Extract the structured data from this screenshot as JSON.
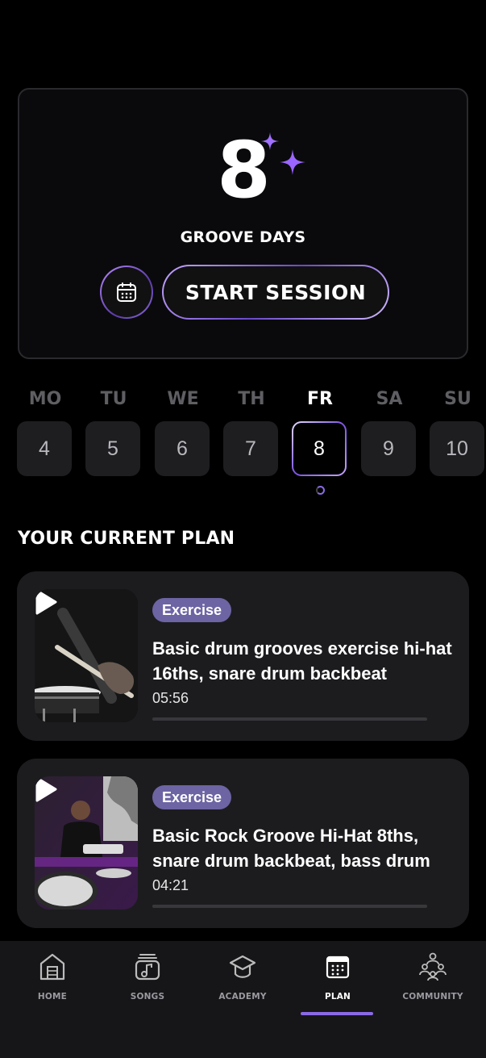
{
  "streak": {
    "count": "8",
    "label": "GROOVE DAYS"
  },
  "actions": {
    "start_label": "START SESSION"
  },
  "week": [
    {
      "name": "MO",
      "num": "4"
    },
    {
      "name": "TU",
      "num": "5"
    },
    {
      "name": "WE",
      "num": "6"
    },
    {
      "name": "TH",
      "num": "7"
    },
    {
      "name": "FR",
      "num": "8",
      "active": true
    },
    {
      "name": "SA",
      "num": "9"
    },
    {
      "name": "SU",
      "num": "10"
    }
  ],
  "plan": {
    "title": "YOUR CURRENT PLAN",
    "items": [
      {
        "badge": "Exercise",
        "title": "Basic drum grooves exercise hi-hat 16ths, snare drum backbeat",
        "duration": "05:56",
        "progress": 0
      },
      {
        "badge": "Exercise",
        "title": "Basic Rock Groove Hi-Hat 8ths, snare drum backbeat, bass drum",
        "duration": "04:21",
        "progress": 0
      }
    ]
  },
  "nav": {
    "items": [
      {
        "label": "HOME",
        "icon": "home-icon"
      },
      {
        "label": "SONGS",
        "icon": "music-note-icon"
      },
      {
        "label": "ACADEMY",
        "icon": "graduation-cap-icon"
      },
      {
        "label": "PLAN",
        "icon": "calendar-icon",
        "active": true
      },
      {
        "label": "COMMUNITY",
        "icon": "community-icon"
      }
    ]
  },
  "colors": {
    "accent": "#8a6ae6",
    "badge": "#6c64a3",
    "card": "#1c1c1f",
    "background": "#000000"
  }
}
